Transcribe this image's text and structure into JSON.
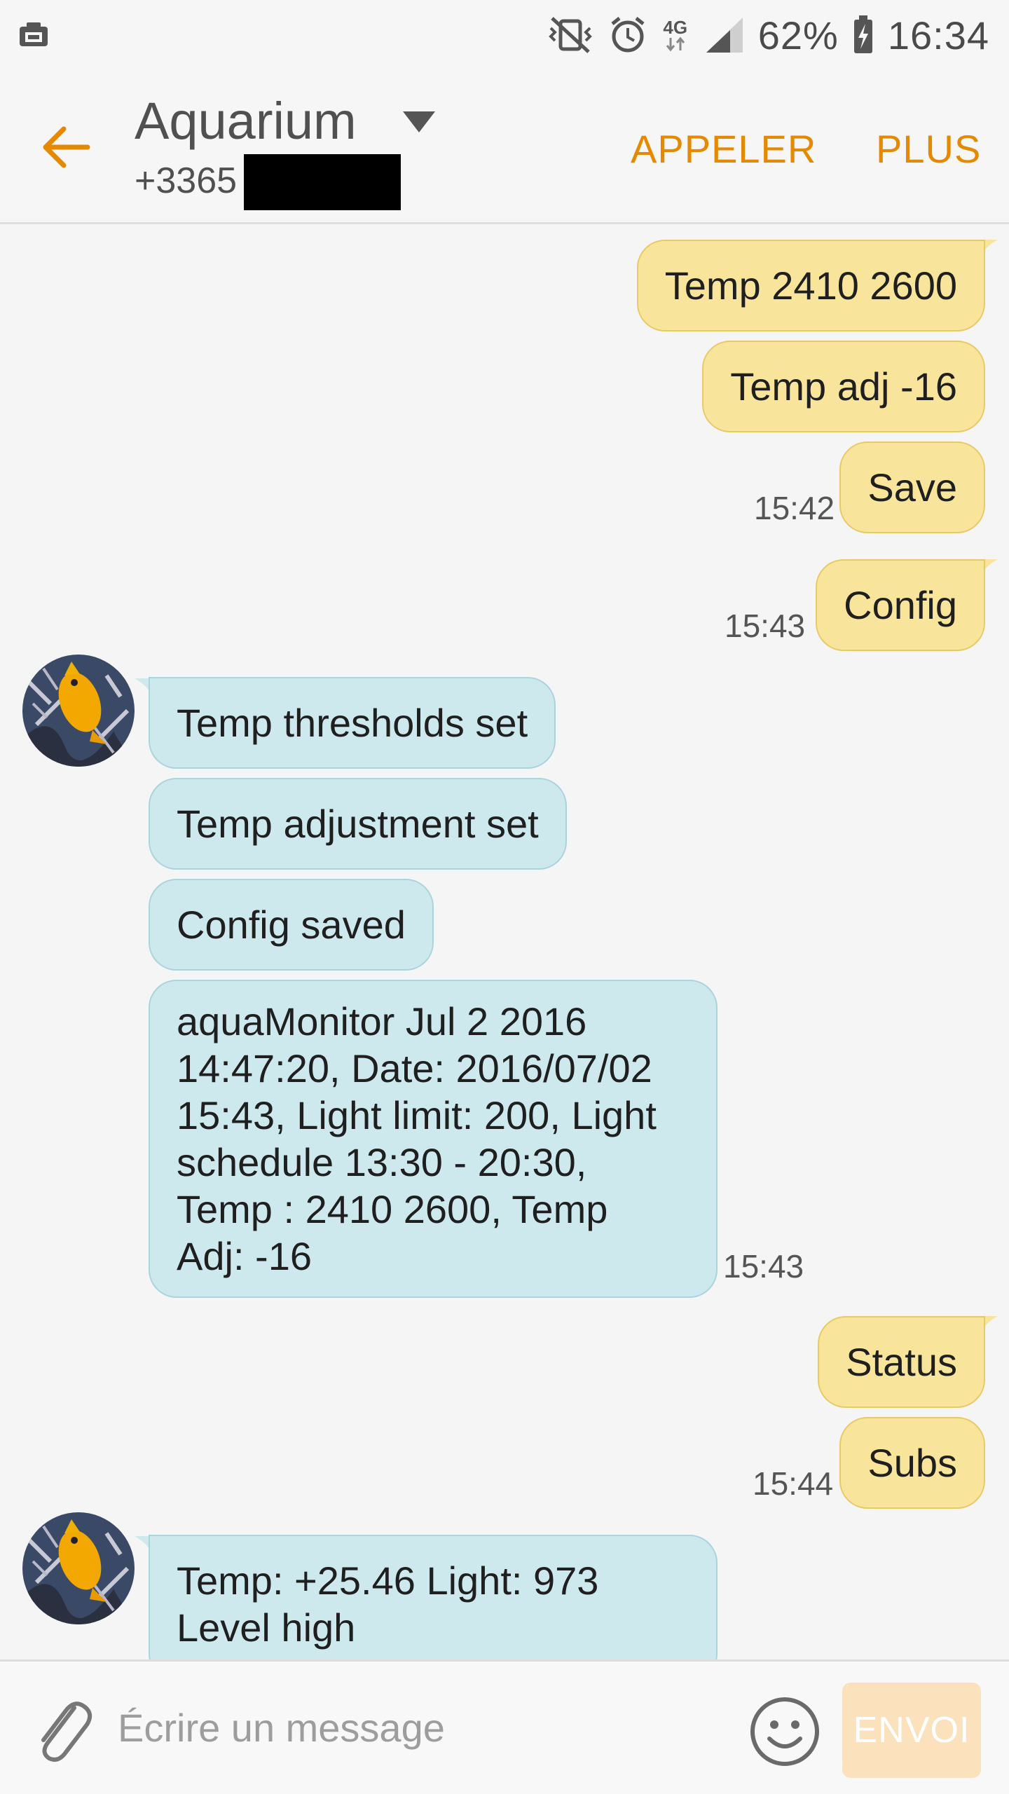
{
  "status_bar": {
    "battery": "62%",
    "time": "16:34",
    "network": "4G",
    "icons": [
      "screenshot-icon",
      "vibrate-off-icon",
      "alarm-icon",
      "network-4g-icon",
      "signal-icon",
      "battery-charging-icon"
    ]
  },
  "header": {
    "contact_name": "Aquarium",
    "contact_number": "+3365",
    "call_label": "APPELER",
    "more_label": "PLUS",
    "accent_color": "#e58a00"
  },
  "messages": [
    {
      "direction": "out",
      "text": "Temp 2410 2600",
      "time": ""
    },
    {
      "direction": "out",
      "text": "Temp adj -16",
      "time": ""
    },
    {
      "direction": "out",
      "text": "Save",
      "time": "15:42"
    },
    {
      "direction": "out",
      "text": "Config",
      "time": "15:43"
    },
    {
      "direction": "in",
      "text": "Temp thresholds set",
      "time": ""
    },
    {
      "direction": "in",
      "text": "Temp adjustment set",
      "time": ""
    },
    {
      "direction": "in",
      "text": "Config saved",
      "time": ""
    },
    {
      "direction": "in",
      "text": "aquaMonitor Jul  2 2016\n14:47:20, Date: 2016/07/02\n15:43, Light limit: 200, Light\nschedule 13:30 - 20:30,\nTemp : 2410 2600, Temp\nAdj: -16",
      "time": "15:43"
    },
    {
      "direction": "out",
      "text": "Status",
      "time": ""
    },
    {
      "direction": "out",
      "text": "Subs",
      "time": "15:44"
    },
    {
      "direction": "in",
      "text": "Temp: +25.46 Light: 973\nLevel high",
      "time": ""
    }
  ],
  "composer": {
    "placeholder": "Écrire un message",
    "send_label": "ENVOI"
  },
  "colors": {
    "outgoing_bubble": "#f8e59b",
    "incoming_bubble": "#cde9ee",
    "send_button": "#fbe2bd"
  }
}
